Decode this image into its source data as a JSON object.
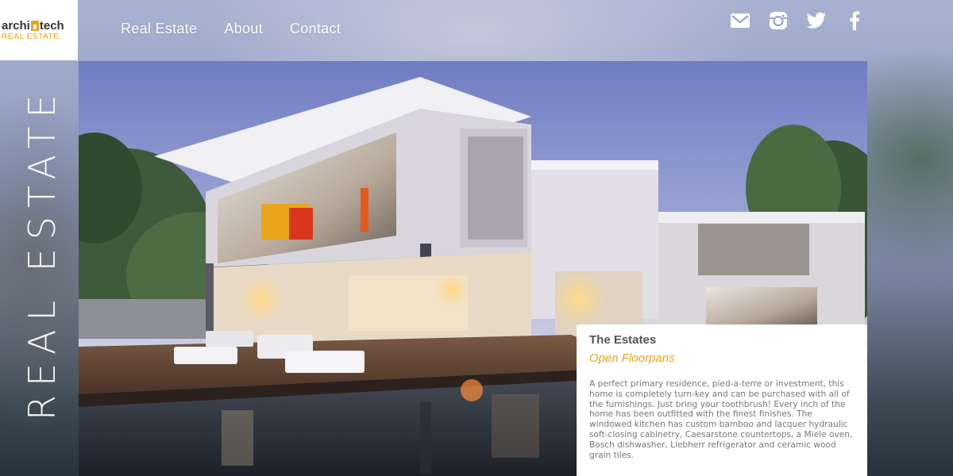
{
  "brand": {
    "logo_part1": "archi",
    "logo_part2": "tech",
    "logo_sub": "REAL ESTATE",
    "accent_color": "#e8a51c"
  },
  "nav": {
    "items": [
      {
        "label": "Real Estate"
      },
      {
        "label": "About"
      },
      {
        "label": "Contact"
      }
    ]
  },
  "social": {
    "icons": [
      "mail-icon",
      "instagram-icon",
      "twitter-icon",
      "facebook-icon"
    ]
  },
  "vertical_title": "REAL ESTATE",
  "card": {
    "title": "The Estates",
    "subtitle": "Open Floorpans",
    "body": "A perfect primary residence, pied-a-terre or investment, this home is completely turn-key and can be purchased with all of the furnishings. Just bring your toothbrush! Every inch of the home has been outfitted with the finest finishes. The windowed kitchen has custom bamboo and lacquer hydraulic soft-closing cabinetry, Caesarstone countertops, a Miele oven, Bosch dishwasher, Liebherr refrigerator and ceramic wood grain tiles."
  }
}
